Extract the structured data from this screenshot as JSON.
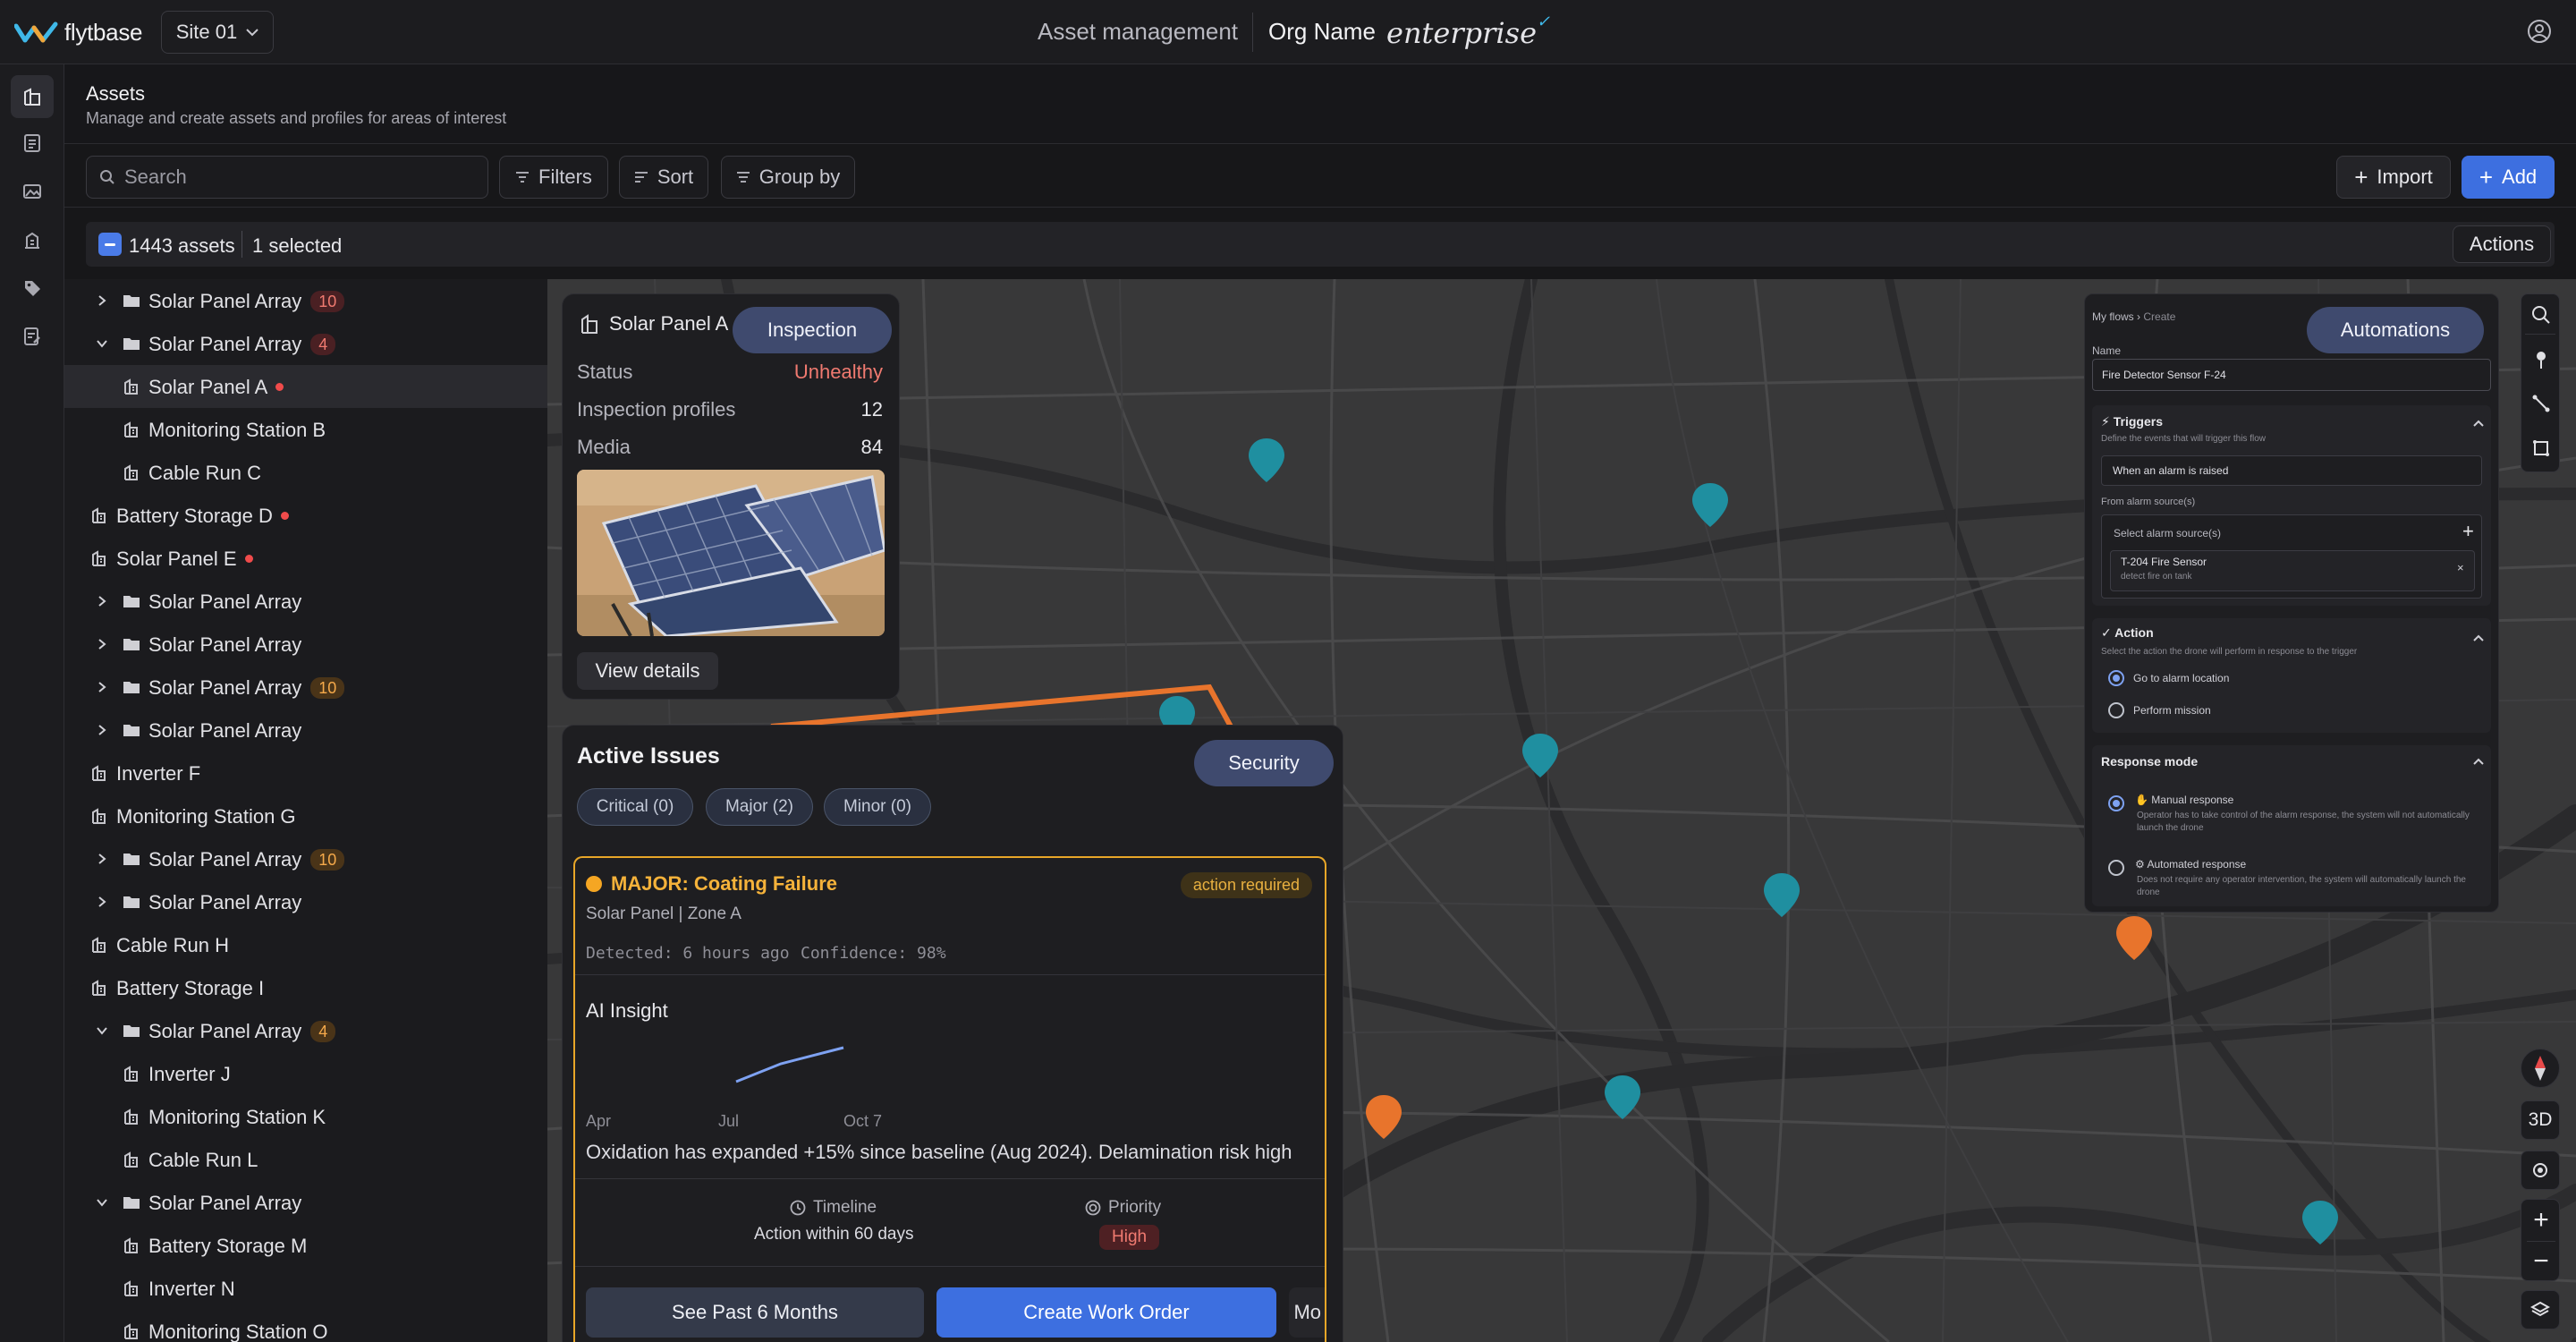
{
  "app": {
    "brand": "flytbase",
    "site": "Site 01",
    "page_title": "Asset management",
    "org_name": "Org Name",
    "plan": "enterprise"
  },
  "header": {
    "title": "Assets",
    "subtitle": "Manage and create assets and profiles for areas of interest"
  },
  "toolbar": {
    "search_placeholder": "Search",
    "filters": "Filters",
    "sort": "Sort",
    "group_by": "Group by",
    "import": "Import",
    "add": "Add"
  },
  "selection": {
    "count": "1443 assets",
    "selected": "1 selected",
    "actions": "Actions"
  },
  "tree": [
    {
      "label": "Solar Panel Array",
      "level": 1,
      "expand": "collapsed",
      "badge": "10",
      "badge_color": "red"
    },
    {
      "label": "Solar Panel Array",
      "level": 1,
      "expand": "expanded",
      "badge": "4",
      "badge_color": "red"
    },
    {
      "label": "Solar Panel A",
      "level": 2,
      "dot": true,
      "selected": true
    },
    {
      "label": "Monitoring Station B",
      "level": 2
    },
    {
      "label": "Cable Run C",
      "level": 2
    },
    {
      "label": "Battery Storage D",
      "level": 0,
      "dot": true
    },
    {
      "label": "Solar Panel E",
      "level": 0,
      "dot": true
    },
    {
      "label": "Solar Panel Array",
      "level": 1,
      "expand": "collapsed"
    },
    {
      "label": "Solar Panel Array",
      "level": 1,
      "expand": "collapsed"
    },
    {
      "label": "Solar Panel Array",
      "level": 1,
      "expand": "collapsed",
      "badge": "10",
      "badge_color": "orange"
    },
    {
      "label": "Solar Panel Array",
      "level": 1,
      "expand": "collapsed"
    },
    {
      "label": "Inverter F",
      "level": 0
    },
    {
      "label": "Monitoring Station G",
      "level": 0
    },
    {
      "label": "Solar Panel Array",
      "level": 1,
      "expand": "collapsed",
      "badge": "10",
      "badge_color": "orange"
    },
    {
      "label": "Solar Panel Array",
      "level": 1,
      "expand": "collapsed"
    },
    {
      "label": "Cable Run H",
      "level": 0
    },
    {
      "label": "Battery Storage I",
      "level": 0
    },
    {
      "label": "Solar Panel Array",
      "level": 1,
      "expand": "expanded",
      "badge": "4",
      "badge_color": "orange"
    },
    {
      "label": "Inverter J",
      "level": 2
    },
    {
      "label": "Monitoring Station K",
      "level": 2
    },
    {
      "label": "Cable Run L",
      "level": 2
    },
    {
      "label": "Solar Panel Array",
      "level": 1,
      "expand": "expanded"
    },
    {
      "label": "Battery Storage M",
      "level": 2
    },
    {
      "label": "Inverter N",
      "level": 2
    },
    {
      "label": "Monitoring Station O",
      "level": 2
    }
  ],
  "asset_card": {
    "name": "Solar Panel A",
    "tag": "Inspection",
    "status_label": "Status",
    "status_value": "Unhealthy",
    "profiles_label": "Inspection profiles",
    "profiles_value": "12",
    "media_label": "Media",
    "media_value": "84",
    "view_details": "View details"
  },
  "issues": {
    "title": "Active Issues",
    "tag": "Security",
    "chips": [
      "Critical (0)",
      "Major (2)",
      "Minor (0)"
    ],
    "issue_title": "MAJOR: Coating Failure",
    "issue_badge": "action required",
    "issue_location": "Solar Panel | Zone A",
    "detected": "Detected: 6 hours ago",
    "confidence": "Confidence: 98%",
    "ai_insight": "AI Insight",
    "insight_text": "Oxidation has expanded +15% since baseline (Aug 2024). Delamination risk high",
    "timeline_label": "Timeline",
    "timeline_value": "Action within 60 days",
    "priority_label": "Priority",
    "priority_value": "High",
    "see_past": "See Past 6 Months",
    "create_wo": "Create Work Order",
    "more": "Mo"
  },
  "chart_data": {
    "type": "line",
    "x": [
      "Apr",
      "Jul",
      "Oct 7"
    ],
    "series": [
      {
        "values": [
          null,
          1.0,
          2.9
        ]
      }
    ],
    "tick_labels": [
      "Apr",
      "Jul",
      "Oct 7"
    ]
  },
  "automations": {
    "breadcrumb_root": "My flows",
    "breadcrumb_current": "Create",
    "tag": "Automations",
    "name_label": "Name",
    "name_value": "Fire Detector Sensor F-24",
    "triggers_title": "Triggers",
    "triggers_desc": "Define the events that will trigger this flow",
    "trigger_value": "When an alarm is raised",
    "alarm_source_label": "From alarm source(s)",
    "alarm_source_placeholder": "Select alarm source(s)",
    "source_name": "T-204 Fire Sensor",
    "source_desc": "detect fire on tank",
    "action_title": "Action",
    "action_desc": "Select the action the drone will perform in response to the trigger",
    "action_opt1": "Go to alarm location",
    "action_opt2": "Perform mission",
    "response_title": "Response mode",
    "manual_title": "Manual response",
    "manual_desc": "Operator has to take control of the alarm response, the system will not automatically launch the drone",
    "auto_title": "Automated response",
    "auto_desc": "Does not require any operator intervention, the system will automatically launch the drone"
  },
  "map_controls": {
    "three_d": "3D"
  },
  "colors": {
    "accent": "#3d6fe0",
    "pill": "#3f4a6e",
    "unhealthy": "#f07a70",
    "major": "#f5a623",
    "marker_teal": "#1f8fa0",
    "marker_orange": "#e8742c"
  }
}
